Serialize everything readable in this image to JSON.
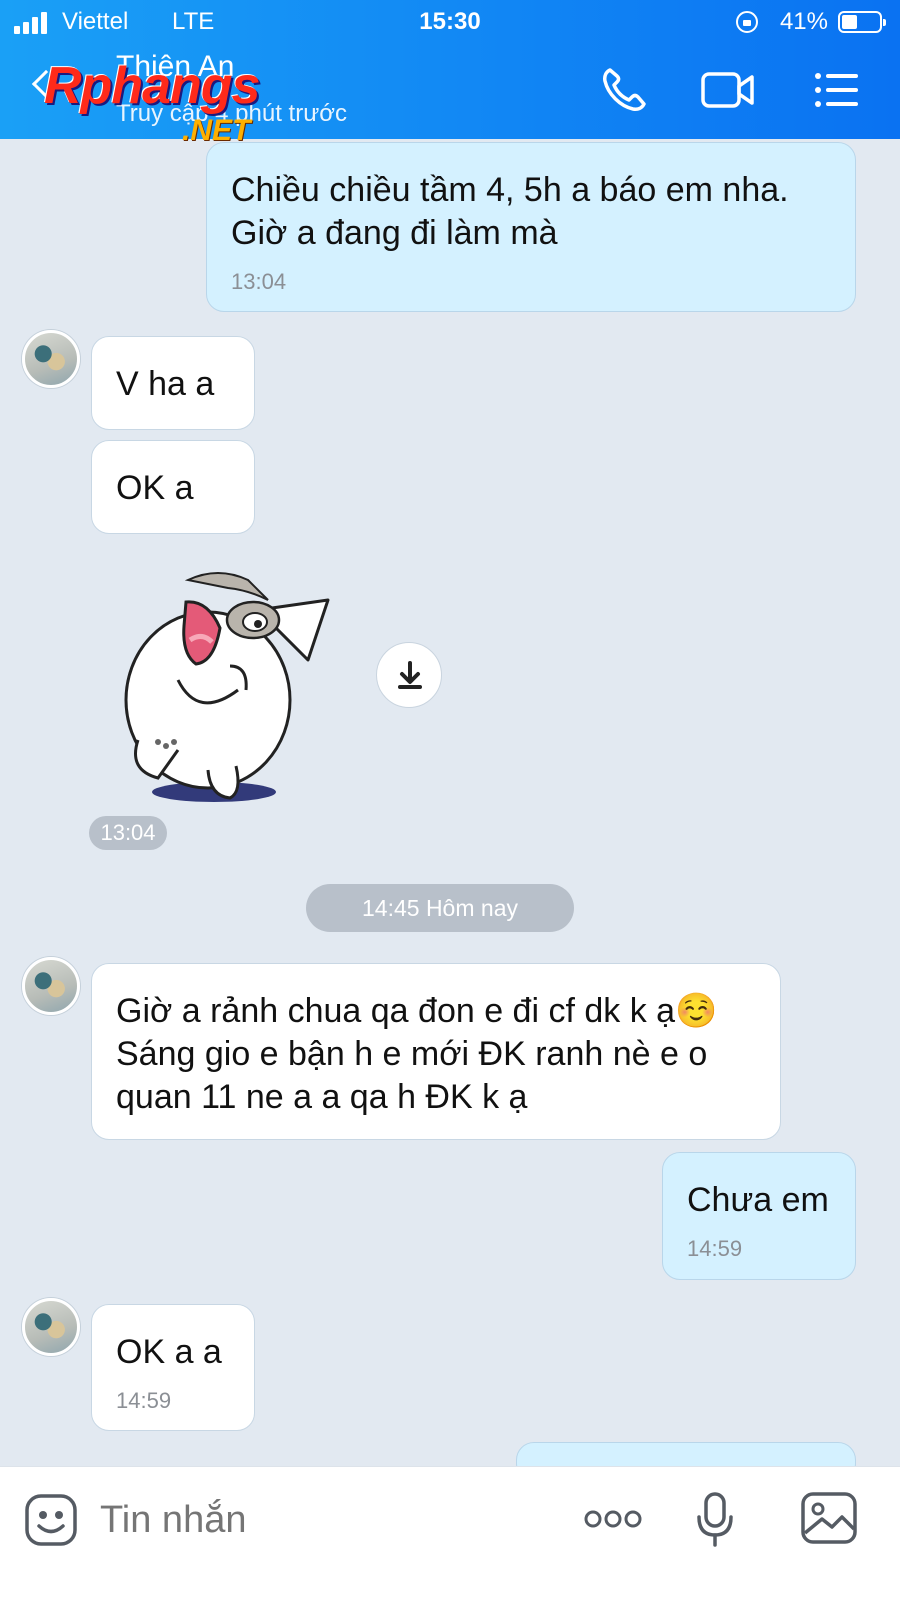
{
  "status_bar": {
    "carrier": "Viettel",
    "network": "LTE",
    "time": "15:30",
    "battery": "41%"
  },
  "header": {
    "contact_name": "Thiên An",
    "contact_status": "Truy cập 4 phút trước",
    "watermark": "Rphangs",
    "watermark_sub": ".NET"
  },
  "messages": [
    {
      "id": "m1",
      "from": "me",
      "text": "Chiều chiều tầm 4, 5h a báo em nha. Giờ a đang đi làm mà",
      "time": "13:04"
    },
    {
      "id": "m2",
      "from": "contact",
      "text": "V ha a"
    },
    {
      "id": "m3",
      "from": "contact",
      "text": "OK a"
    },
    {
      "id": "m4",
      "from": "contact",
      "type": "sticker",
      "time": "13:04"
    },
    {
      "id": "m5",
      "from": "contact",
      "text": "Giờ a rảnh chua qa đon e đi cf dk k ạ☺️ Sáng gio e bận h e mới ĐK ranh nè e o quan 11 ne a a qa h ĐK k ạ"
    },
    {
      "id": "m6",
      "from": "me",
      "text": "Chưa em",
      "time": "14:59"
    },
    {
      "id": "m7",
      "from": "contact",
      "text": "OK a a",
      "time": "14:59"
    }
  ],
  "date_separator": "14:45 Hôm nay",
  "composer": {
    "placeholder": "Tin nhắn"
  },
  "icons": [
    "back-icon",
    "phone-icon",
    "video-icon",
    "menu-icon",
    "download-icon",
    "emoji-icon",
    "more-icon",
    "mic-icon",
    "gallery-icon",
    "lock-rotation-icon"
  ],
  "colors": {
    "header": "#0a72f2",
    "outgoing_bubble": "#d4f1ff",
    "incoming_bubble": "#ffffff",
    "chat_bg": "#e2e9f1"
  }
}
